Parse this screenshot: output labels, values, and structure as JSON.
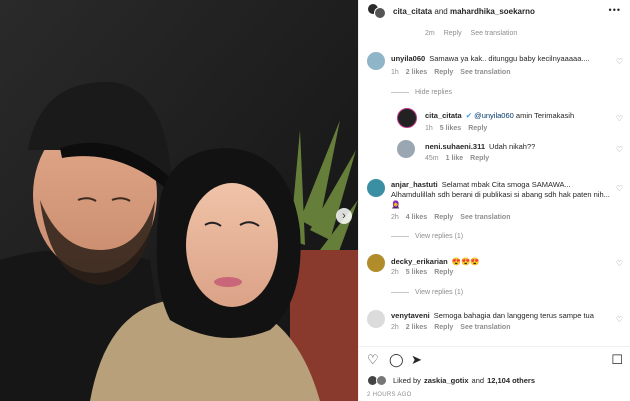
{
  "header": {
    "user1": "cita_citata",
    "joiner": "and",
    "user2": "mahardhika_soekarno",
    "more": "•••"
  },
  "top_meta": {
    "time": "2m",
    "reply": "Reply",
    "translation": "See translation"
  },
  "comments": [
    {
      "user": "unyila060",
      "text": "Samawa ya kak.. ditunggu baby kecilnyaaaaa....",
      "time": "1h",
      "likes": "2 likes",
      "reply": "Reply",
      "translation": "See translation"
    },
    {
      "user": "cita_citata",
      "mention": "@unyila060",
      "text": "amin Terimakasih",
      "time": "1h",
      "likes": "5 likes",
      "reply": "Reply"
    },
    {
      "user": "neni.suhaeni.311",
      "text": "Udah nikah??",
      "time": "45m",
      "likes": "1 like",
      "reply": "Reply"
    },
    {
      "user": "anjar_hastuti",
      "text": "Selamat mbak Cita smoga SAMAWA... Alhamdulillah sdh berani di publikasi si abang sdh hak paten nih...🧕",
      "time": "2h",
      "likes": "4 likes",
      "reply": "Reply",
      "translation": "See translation"
    },
    {
      "user": "decky_erikarian",
      "text": "😍😍😍",
      "time": "2h",
      "likes": "5 likes",
      "reply": "Reply"
    },
    {
      "user": "venytaveni",
      "text": "Semoga bahagia dan langgeng terus sampe tua",
      "time": "2h",
      "likes": "2 likes",
      "reply": "Reply",
      "translation": "See translation"
    }
  ],
  "toggles": {
    "hide": "Hide replies",
    "view1": "View replies (1)",
    "view2": "View replies (1)"
  },
  "icons": {
    "heart": "heart-icon",
    "comment": "comment-icon",
    "share": "share-icon",
    "save": "bookmark-icon",
    "next": "chevron-right-icon"
  },
  "likes": {
    "prefix": "Liked by",
    "user": "zaskia_gotix",
    "joiner": "and",
    "count": "12,104 others"
  },
  "timestamp": "2 HOURS AGO"
}
